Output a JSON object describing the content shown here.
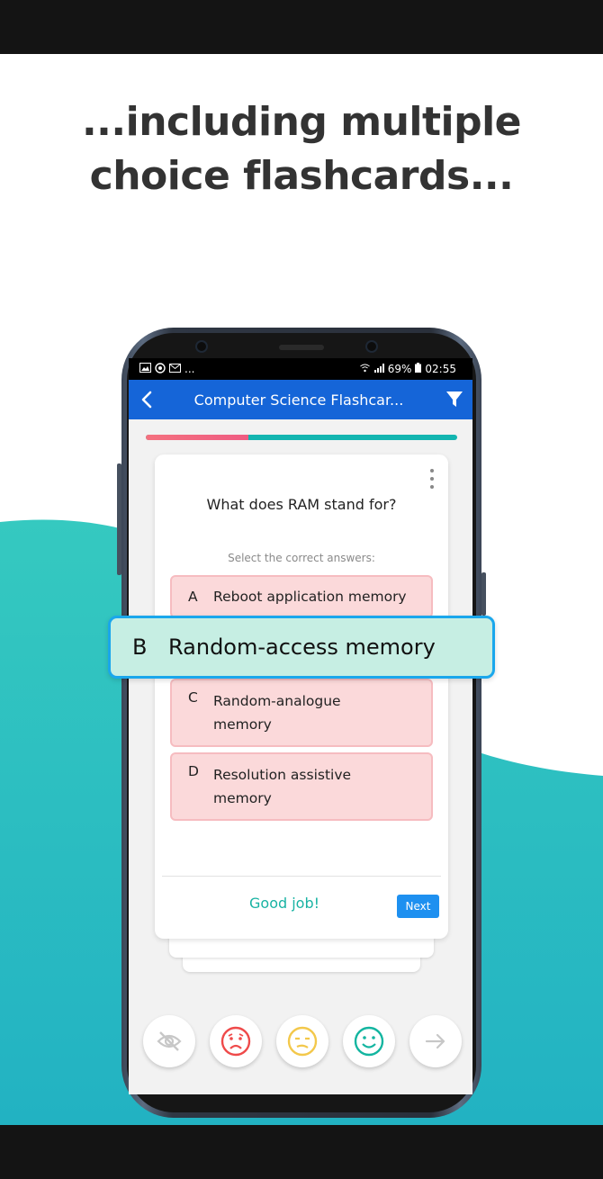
{
  "headline": {
    "line1": "...including multiple",
    "line2": "choice flashcards..."
  },
  "status_bar": {
    "left_icons": [
      "image-icon",
      "sync-icon",
      "mail-icon"
    ],
    "left_overflow": "...",
    "battery": "69%",
    "time": "02:55"
  },
  "app_bar": {
    "title": "Computer Science Flashcar...",
    "back_icon": "chevron-left-icon",
    "filter_icon": "filter-icon"
  },
  "progress": {
    "fraction": 0.33,
    "done_color": "#f06a80",
    "remaining_color": "#13b5b0"
  },
  "card": {
    "question": "What does RAM stand for?",
    "instruction": "Select the correct answers:",
    "options": [
      {
        "letter": "A",
        "text": "Reboot application memory",
        "state": "incorrect"
      },
      {
        "letter": "B",
        "text": "Random-access memory",
        "state": "correct"
      },
      {
        "letter": "C",
        "text": "Random-analogue memory",
        "state": "incorrect"
      },
      {
        "letter": "D",
        "text": "Resolution assistive memory",
        "state": "incorrect"
      }
    ],
    "feedback": "Good job!",
    "next_label": "Next"
  },
  "rating_buttons": [
    {
      "icon": "hide-icon",
      "color": "#c7c7c7"
    },
    {
      "icon": "sad-face-icon",
      "color": "#ef4a4a"
    },
    {
      "icon": "neutral-face-icon",
      "color": "#f3c84b"
    },
    {
      "icon": "happy-face-icon",
      "color": "#13b5a0"
    },
    {
      "icon": "arrow-right-icon",
      "color": "#c7c7c7"
    }
  ],
  "colors": {
    "accent_teal": "#27b7bd",
    "app_bar_blue": "#1565d8",
    "correct_highlight": "#c6eee3",
    "incorrect_option": "#fbd9da"
  }
}
